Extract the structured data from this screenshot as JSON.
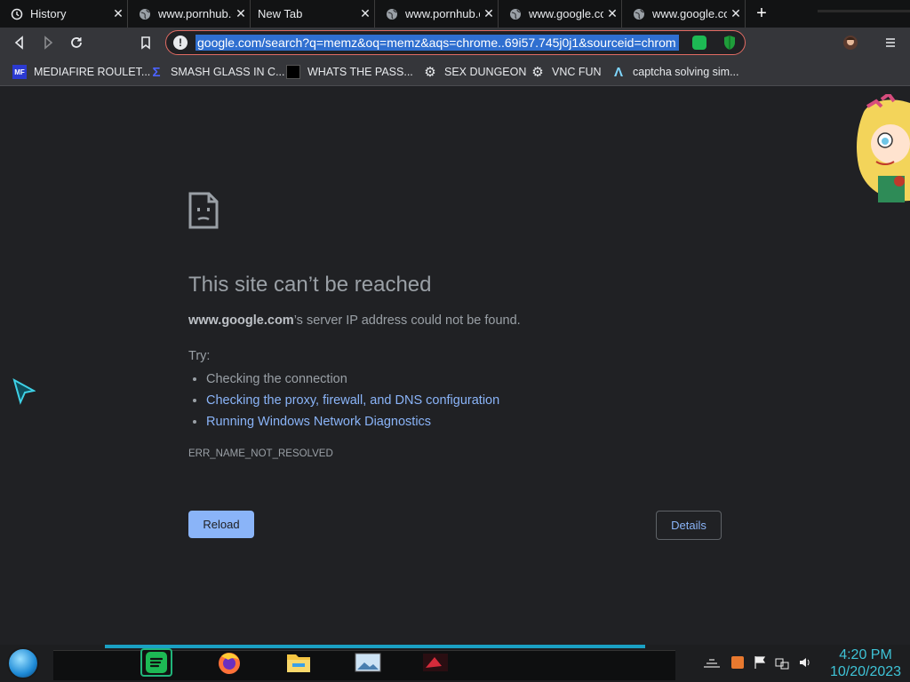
{
  "tabs": [
    {
      "title": "History",
      "icon": "history-icon",
      "active": false
    },
    {
      "title": "www.pornhub.c",
      "icon": "globe-icon",
      "active": false
    },
    {
      "title": "New Tab",
      "icon": "",
      "active": false
    },
    {
      "title": "www.pornhub.c",
      "icon": "globe-icon",
      "active": false
    },
    {
      "title": "www.google.co",
      "icon": "globe-icon",
      "active": false
    },
    {
      "title": "www.google.co",
      "icon": "globe-icon",
      "active": true
    }
  ],
  "new_tab_label": "+",
  "omnibox": {
    "url": "google.com/search?q=memz&oq=memz&aqs=chrome..69i57.745j0j1&sourceid=chrom",
    "info": "!"
  },
  "bookmarks": [
    {
      "label": "MEDIAFIRE ROULET...",
      "icon": "mediafire-icon",
      "icon_text": "MF"
    },
    {
      "label": "SMASH GLASS IN C...",
      "icon": "sigma-icon",
      "icon_text": "Σ"
    },
    {
      "label": "WHATS THE PASS...",
      "icon": "dark-box-icon",
      "icon_text": ""
    },
    {
      "label": "SEX DUNGEON",
      "icon": "gear-icon",
      "icon_text": "⚙"
    },
    {
      "label": "VNC FUN",
      "icon": "gear-icon",
      "icon_text": "⚙"
    },
    {
      "label": "captcha solving sim...",
      "icon": "lambda-icon",
      "icon_text": "Λ"
    }
  ],
  "error": {
    "title": "This site can’t be reached",
    "host": "www.google.com",
    "desc_rest": "’s server IP address could not be found.",
    "try_label": "Try:",
    "suggestions": [
      {
        "text": "Checking the connection",
        "link": false
      },
      {
        "text": "Checking the proxy, firewall, and DNS configuration",
        "link": true
      },
      {
        "text": "Running Windows Network Diagnostics",
        "link": true
      }
    ],
    "code": "ERR_NAME_NOT_RESOLVED",
    "reload_label": "Reload",
    "details_label": "Details"
  },
  "taskbar": {
    "apps": [
      "spotify-icon",
      "firefox-icon",
      "file-explorer-icon",
      "photos-icon",
      "media-icon"
    ],
    "tray": [
      "network-icon",
      "flag-icon",
      "wifi-icon",
      "volume-icon"
    ],
    "time": "4:20 PM",
    "date": "10/20/2023"
  },
  "colors": {
    "background": "#202124",
    "toolbar": "#35363a",
    "link": "#8ab4f8",
    "reload_button": "#8ab4f8",
    "omnibox_border": "#e26b63",
    "clock": "#3ec3d6"
  }
}
